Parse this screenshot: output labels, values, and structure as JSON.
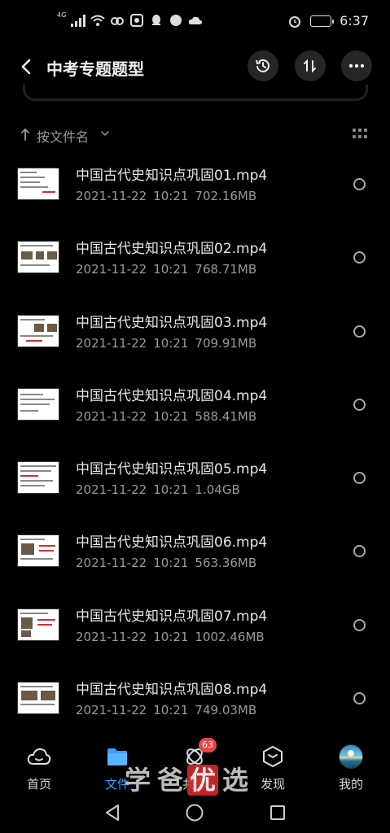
{
  "status_bar": {
    "network": "4G",
    "time": "6:37",
    "icons": [
      "signal-icon",
      "wifi-icon",
      "link-icon",
      "app-notification-icon",
      "qq-icon",
      "compass-icon",
      "cloud-icon",
      "alarm-icon",
      "battery-icon"
    ]
  },
  "header": {
    "title": "中考专题题型",
    "back_icon": "back-arrow-icon",
    "actions": [
      "history-icon",
      "sort-icon",
      "more-icon"
    ]
  },
  "sort": {
    "label": "按文件名",
    "direction_icon": "arrow-up-icon",
    "view_icon": "grid-view-icon"
  },
  "files": [
    {
      "name": "中国古代史知识点巩固01.mp4",
      "date": "2021-11-22",
      "time": "10:21",
      "size": "702.16MB"
    },
    {
      "name": "中国古代史知识点巩固02.mp4",
      "date": "2021-11-22",
      "time": "10:21",
      "size": "768.71MB"
    },
    {
      "name": "中国古代史知识点巩固03.mp4",
      "date": "2021-11-22",
      "time": "10:21",
      "size": "709.91MB"
    },
    {
      "name": "中国古代史知识点巩固04.mp4",
      "date": "2021-11-22",
      "time": "10:21",
      "size": "588.41MB"
    },
    {
      "name": "中国古代史知识点巩固05.mp4",
      "date": "2021-11-22",
      "time": "10:21",
      "size": "1.04GB"
    },
    {
      "name": "中国古代史知识点巩固06.mp4",
      "date": "2021-11-22",
      "time": "10:21",
      "size": "563.36MB"
    },
    {
      "name": "中国古代史知识点巩固07.mp4",
      "date": "2021-11-22",
      "time": "10:21",
      "size": "1002.46MB"
    },
    {
      "name": "中国古代史知识点巩固08.mp4",
      "date": "2021-11-22",
      "time": "10:21",
      "size": "749.03MB"
    }
  ],
  "bottom_nav": {
    "items": [
      {
        "label": "首页",
        "icon": "cloud-home-icon"
      },
      {
        "label": "文件",
        "icon": "folder-icon",
        "active": true
      },
      {
        "label": "共享",
        "icon": "share-icon",
        "badge": "63"
      },
      {
        "label": "发现",
        "icon": "discover-icon"
      },
      {
        "label": "我的",
        "icon": "avatar"
      }
    ]
  },
  "watermark": [
    "学",
    "爸",
    "优",
    "选"
  ],
  "colors": {
    "accent": "#3aa0ff",
    "badge": "#e8454b",
    "background": "#000000"
  }
}
